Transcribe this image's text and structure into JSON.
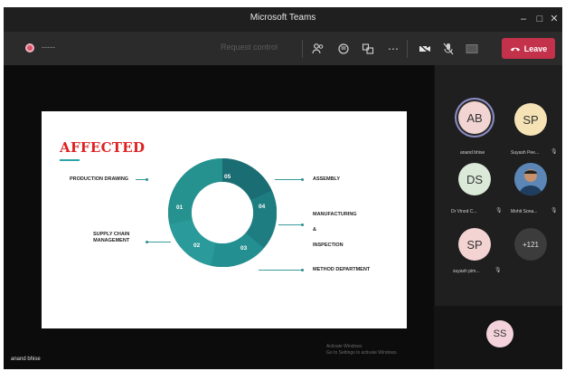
{
  "window": {
    "title": "Microsoft Teams"
  },
  "toolbar": {
    "timer": "-----",
    "request_control": "Request control",
    "leave_label": "Leave",
    "colors": {
      "leave": "#c4314b"
    }
  },
  "slide": {
    "title": "AFFECTED",
    "labels": {
      "production_drawing": "PRODUCTION DRAWING",
      "supply_chain": "SUPPLY CHAIN\nMANAGEMENT",
      "assembly": "ASSEMBLY",
      "manufacturing": "MANUFACTURING",
      "amp": "&",
      "inspection": "INSPECTION",
      "method_department": "METHOD DEPARTMENT"
    },
    "segments": [
      "01",
      "02",
      "03",
      "04",
      "05"
    ],
    "colors": {
      "accent": "#2aa6ab",
      "title": "#e02020"
    }
  },
  "watermark": {
    "line1": "Activate Windows",
    "line2": "Go to Settings to activate Windows."
  },
  "stage": {
    "speaker_name": "anand bhise"
  },
  "participants": [
    {
      "initials": "AB",
      "name": "anand bhise",
      "color": "#f2d5d2"
    },
    {
      "initials": "SP",
      "name": "Suyash Pee...",
      "color": "#f5e3b5"
    },
    {
      "initials": "DS",
      "name": "Dr Vinod C...",
      "color": "#dbe9d8"
    },
    {
      "initials": "",
      "name": "Mohit Sona...",
      "color": "#3f6a9a"
    },
    {
      "initials": "SP",
      "name": "suyash pim...",
      "color": "#f4d3d3"
    },
    {
      "initials": "+121",
      "name": "",
      "color": "#3c3c3c"
    },
    {
      "initials": "SS",
      "name": "",
      "color": "#f4d3dc"
    }
  ]
}
